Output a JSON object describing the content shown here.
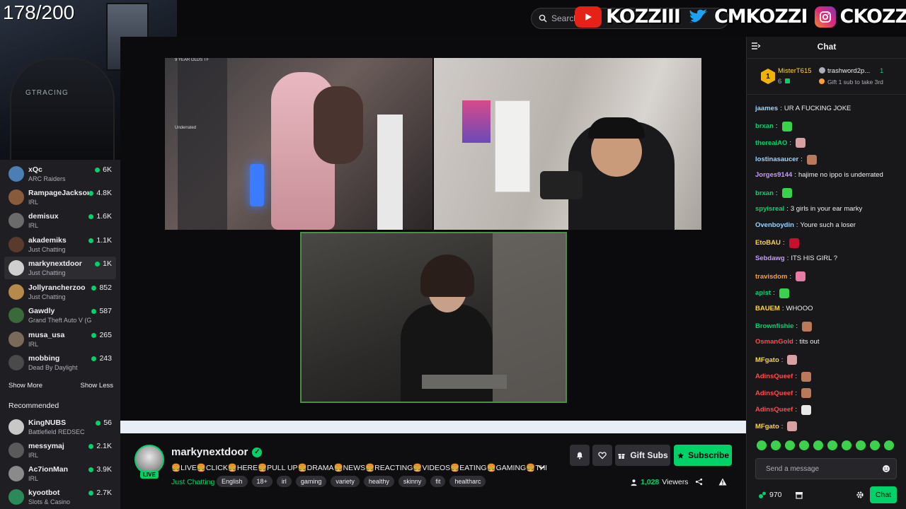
{
  "overlay": {
    "counter": "178/200",
    "socials": [
      {
        "icon": "youtube-icon",
        "handle": "KOZZIII",
        "color": "#e62117"
      },
      {
        "icon": "twitter-icon",
        "handle": "CMKOZZI",
        "color": "#1da1f2"
      },
      {
        "icon": "instagram-icon",
        "handle": "CKOZZI",
        "color": "#c13584"
      }
    ],
    "chair_logo": "GTRACING"
  },
  "search": {
    "placeholder": "Search"
  },
  "sidebar": {
    "channels": [
      {
        "name": "xQc",
        "category": "ARC Raiders",
        "viewers": "6K",
        "color": "#4a7fb5"
      },
      {
        "name": "RampageJackson",
        "category": "IRL",
        "viewers": "4.8K",
        "color": "#8a5a3c"
      },
      {
        "name": "demisux",
        "category": "IRL",
        "viewers": "1.6K",
        "color": "#6b6b6b"
      },
      {
        "name": "akademiks",
        "category": "Just Chatting",
        "viewers": "1.1K",
        "color": "#5a3a2a"
      },
      {
        "name": "markynextdoor",
        "category": "Just Chatting",
        "viewers": "1K",
        "color": "#cfcfcf"
      },
      {
        "name": "Jollyrancherzoo",
        "category": "Just Chatting",
        "viewers": "852",
        "color": "#b58a4a"
      },
      {
        "name": "Gawdly",
        "category": "Grand Theft Auto V (G...",
        "viewers": "587",
        "color": "#3a6a3a"
      },
      {
        "name": "musa_usa",
        "category": "IRL",
        "viewers": "265",
        "color": "#7a6a5a"
      },
      {
        "name": "mobbing",
        "category": "Dead By Daylight",
        "viewers": "243",
        "color": "#4a4a4a"
      }
    ],
    "show_more": "Show More",
    "show_less": "Show Less",
    "recommended_heading": "Recommended",
    "recommended": [
      {
        "name": "KingNUBS",
        "category": "Battlefield REDSEC",
        "viewers": "56",
        "color": "#c8c8c8"
      },
      {
        "name": "messymaj",
        "category": "IRL",
        "viewers": "2.1K",
        "color": "#5a5a5a"
      },
      {
        "name": "Ac7ionMan",
        "category": "IRL",
        "viewers": "3.9K",
        "color": "#8a8a8a"
      },
      {
        "name": "kyootbot",
        "category": "Slots & Casino",
        "viewers": "2.7K",
        "color": "#2a8a5a"
      }
    ]
  },
  "video": {
    "tile1_caption": "9 YEAR OLDS TF",
    "tile1_side": "Underrated"
  },
  "stream": {
    "streamer": "markynextdoor",
    "live_badge": "LIVE",
    "title": "🍔LIVE🍔CLICK🍔HERE🍔PULL UP🍔DRAMA🍔NEWS🍔REACTING🍔VIDEOS🍔EATING🍔GAMING🍔THE BI...",
    "category": "Just Chatting",
    "tags": [
      "English",
      "18+",
      "irl",
      "gaming",
      "variety",
      "healthy",
      "skinny",
      "fit",
      "healtharc"
    ],
    "gift_subs_label": "Gift Subs",
    "subscribe_label": "Subscribe",
    "viewer_count": "1,028",
    "viewers_label": "Viewers"
  },
  "chat": {
    "title": "Chat",
    "pinned": {
      "rank": "1",
      "user": "MisterT615",
      "user_count": "6",
      "user2": "trashword2p...",
      "user2_rank": "1",
      "gift_text": "Gift 1 sub to take 3rd"
    },
    "messages": [
      {
        "user": "jaames",
        "text": "UR A FUCKING JOKE",
        "color": "#9bd4ff",
        "emote": ""
      },
      {
        "user": "brxan",
        "text": "",
        "color": "#00d26a",
        "emote": "#3ad14b"
      },
      {
        "user": "therealAO",
        "text": "",
        "color": "#00d26a",
        "emote": "#d8a0a0"
      },
      {
        "user": "lostinasaucer",
        "text": "",
        "color": "#9bd4ff",
        "emote": "#b87a5a"
      },
      {
        "user": "Jorges9144",
        "text": "hajime no ippo is underrated",
        "color": "#c39bff",
        "emote": ""
      },
      {
        "user": "brxan",
        "text": "",
        "color": "#00d26a",
        "emote": "#3ad14b"
      },
      {
        "user": "spyisreal",
        "text": "3 girls in your ear marky",
        "color": "#00d26a",
        "emote": ""
      },
      {
        "user": "Ovenboydin",
        "text": "Youre such a loser",
        "color": "#9bd4ff",
        "emote": ""
      },
      {
        "user": "EtoBAU",
        "text": "",
        "color": "#ffd43b",
        "emote": "#c8102e"
      },
      {
        "user": "Sebdawg",
        "text": "ITS HIS GIRL ?",
        "color": "#c39bff",
        "emote": ""
      },
      {
        "user": "travisdom",
        "text": "",
        "color": "#ff9b3b",
        "emote": "#e87aa8"
      },
      {
        "user": "apist",
        "text": "",
        "color": "#00d26a",
        "emote": "#3ad14b"
      },
      {
        "user": "BAUEM",
        "text": "WHOOO",
        "color": "#ffd43b",
        "emote": ""
      },
      {
        "user": "Brownfishie",
        "text": "",
        "color": "#00d26a",
        "emote": "#b87a5a"
      },
      {
        "user": "OsmanGold",
        "text": "tits out",
        "color": "#ff4b4b",
        "emote": ""
      },
      {
        "user": "MFgato",
        "text": "",
        "color": "#ffd43b",
        "emote": "#d8a0a0"
      },
      {
        "user": "AdinsQueef",
        "text": "",
        "color": "#ff4b4b",
        "emote": "#b87a5a"
      },
      {
        "user": "AdinsQueef",
        "text": "",
        "color": "#ff4b4b",
        "emote": "#b87a5a"
      },
      {
        "user": "AdinsQueef",
        "text": "",
        "color": "#ff4b4b",
        "emote": "#e8e8e8"
      },
      {
        "user": "MFgato",
        "text": "",
        "color": "#ffd43b",
        "emote": "#d8a0a0"
      }
    ],
    "input_placeholder": "Send a message",
    "points": "970",
    "chat_button": "Chat"
  },
  "colors": {
    "accent": "#00d26a",
    "background": "#0e0e10",
    "sidebar": "#1f1f23",
    "chat": "#18181b"
  }
}
